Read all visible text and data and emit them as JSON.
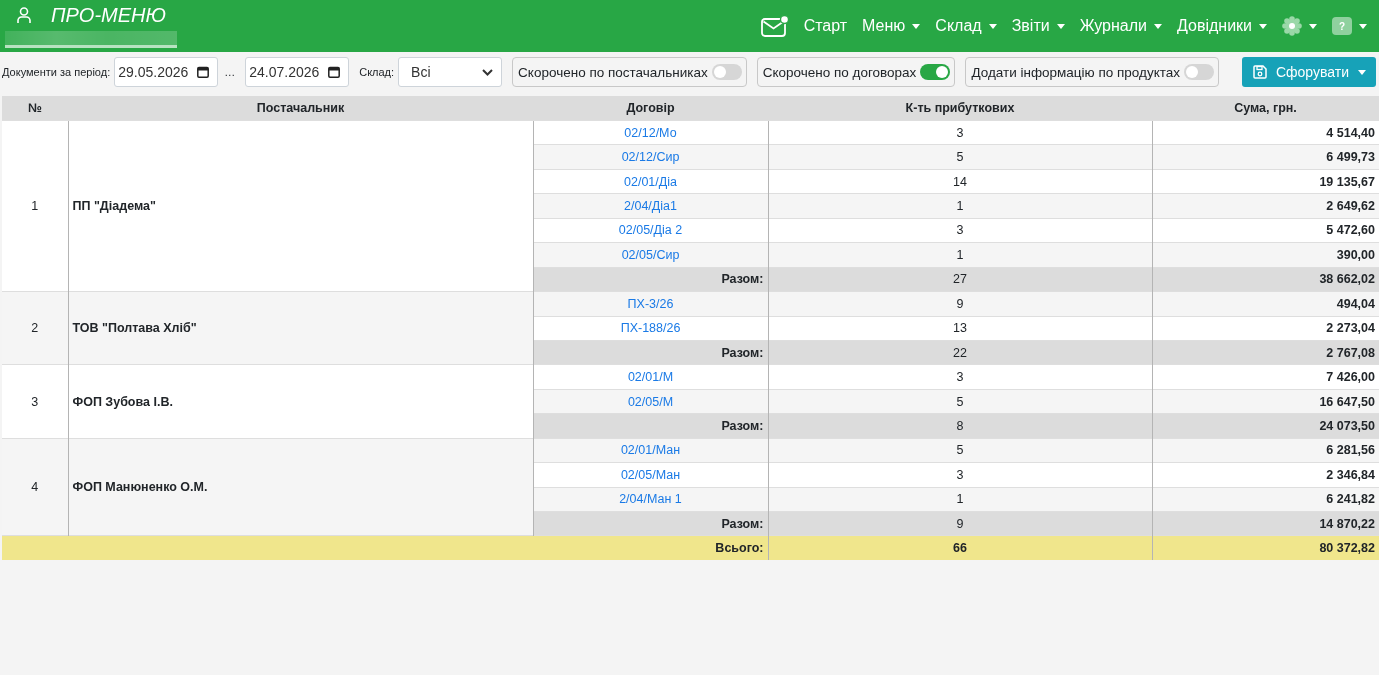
{
  "header": {
    "title": "ПРО-МЕНЮ",
    "nav": [
      {
        "kind": "mail",
        "unread": true,
        "dropdown": false
      },
      {
        "kind": "text",
        "label": "Старт",
        "dropdown": false
      },
      {
        "kind": "text",
        "label": "Меню",
        "dropdown": true
      },
      {
        "kind": "text",
        "label": "Склад",
        "dropdown": true
      },
      {
        "kind": "text",
        "label": "Звіти",
        "dropdown": true
      },
      {
        "kind": "text",
        "label": "Журнали",
        "dropdown": true
      },
      {
        "kind": "text",
        "label": "Довідники",
        "dropdown": true
      },
      {
        "kind": "settings",
        "dropdown": true
      },
      {
        "kind": "help",
        "label": "?",
        "dropdown": true
      }
    ]
  },
  "filters": {
    "period_label": "Документи за період:",
    "date_from": "29.05.2026",
    "range_separator": "…",
    "date_to": "24.07.2026",
    "warehouse_label": "Склад:",
    "warehouse": "Всі",
    "toggles": [
      {
        "label": "Скорочено по постачальниках",
        "on": false
      },
      {
        "label": "Скорочено по договорах",
        "on": true
      },
      {
        "label": "Додати інформацію по продуктах",
        "on": false
      }
    ],
    "submit_label": "Сфорувати"
  },
  "table": {
    "columns": [
      "№",
      "Постачальник",
      "Договір",
      "К-ть прибуткових",
      "Сума, грн."
    ],
    "groups": [
      {
        "number": "1",
        "supplier": "ПП \"Діадема\"",
        "contracts": [
          {
            "contract": "02/12/Мо",
            "count": "3",
            "sum": "4 514,40"
          },
          {
            "contract": "02/12/Сир",
            "count": "5",
            "sum": "6 499,73"
          },
          {
            "contract": "02/01/Діа",
            "count": "14",
            "sum": "19 135,67"
          },
          {
            "contract": "2/04/Діа1",
            "count": "1",
            "sum": "2 649,62"
          },
          {
            "contract": "02/05/Діа 2",
            "count": "3",
            "sum": "5 472,60"
          },
          {
            "contract": "02/05/Сир",
            "count": "1",
            "sum": "390,00"
          }
        ],
        "subtotal": {
          "label": "Разом:",
          "count": "27",
          "sum": "38 662,02"
        }
      },
      {
        "number": "2",
        "supplier": "ТОВ \"Полтава Хліб\"",
        "contracts": [
          {
            "contract": "ПХ-3/26",
            "count": "9",
            "sum": "494,04"
          },
          {
            "contract": "ПХ-188/26",
            "count": "13",
            "sum": "2 273,04"
          }
        ],
        "subtotal": {
          "label": "Разом:",
          "count": "22",
          "sum": "2 767,08"
        }
      },
      {
        "number": "3",
        "supplier": "ФОП Зубова І.В.",
        "contracts": [
          {
            "contract": "02/01/М",
            "count": "3",
            "sum": "7 426,00"
          },
          {
            "contract": "02/05/М",
            "count": "5",
            "sum": "16 647,50"
          }
        ],
        "subtotal": {
          "label": "Разом:",
          "count": "8",
          "sum": "24 073,50"
        }
      },
      {
        "number": "4",
        "supplier": "ФОП Манюненко О.М.",
        "contracts": [
          {
            "contract": "02/01/Ман",
            "count": "5",
            "sum": "6 281,56"
          },
          {
            "contract": "02/05/Ман",
            "count": "3",
            "sum": "2 346,84"
          },
          {
            "contract": "2/04/Ман 1",
            "count": "1",
            "sum": "6 241,82"
          }
        ],
        "subtotal": {
          "label": "Разом:",
          "count": "9",
          "sum": "14 870,22"
        }
      }
    ],
    "total": {
      "label": "Всього:",
      "count": "66",
      "sum": "80 372,82"
    }
  }
}
